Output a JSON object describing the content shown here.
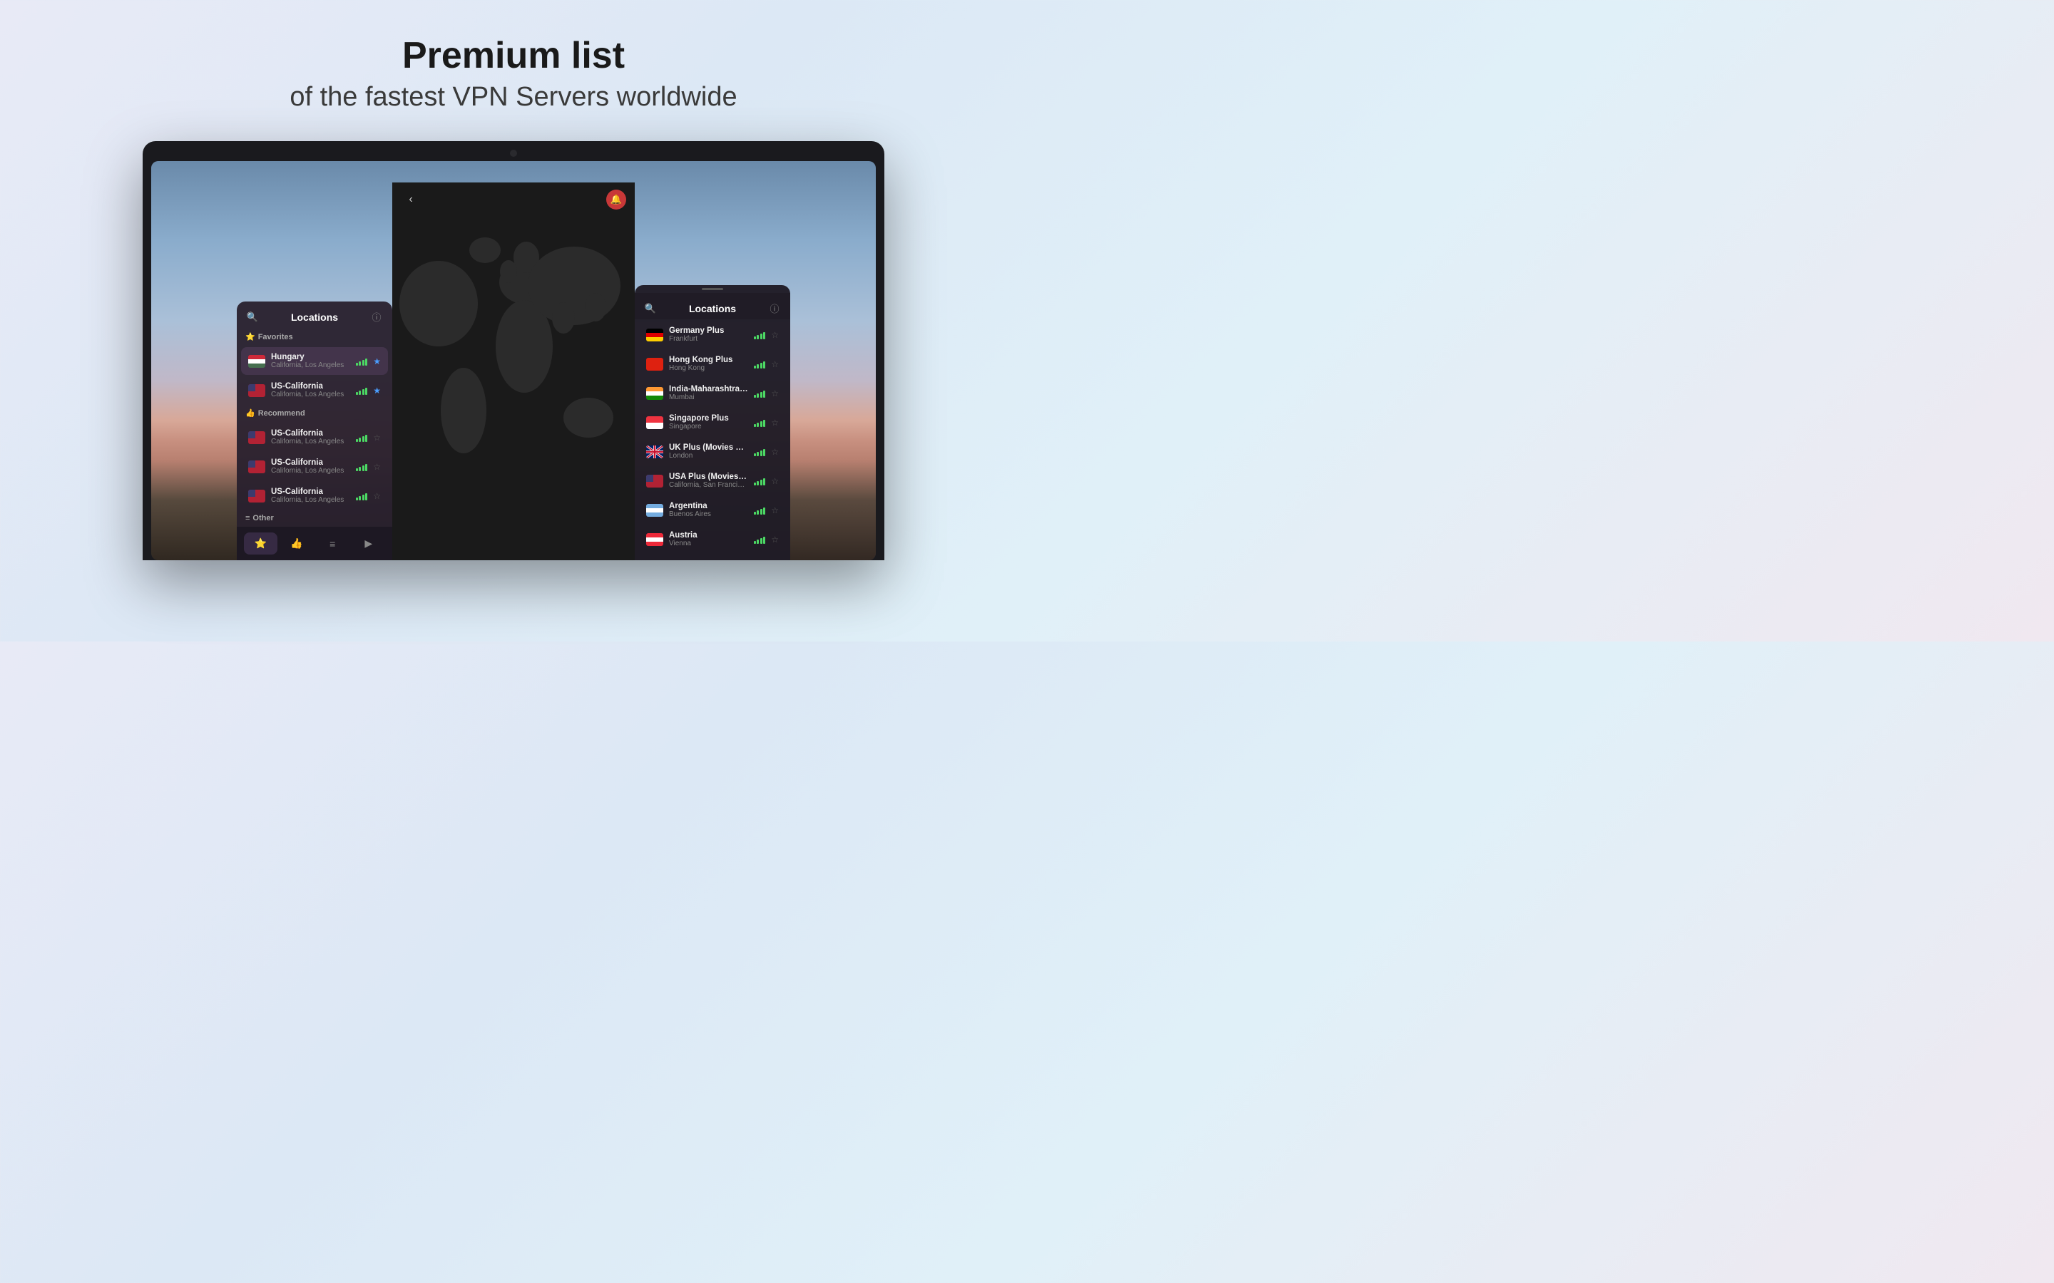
{
  "header": {
    "title": "Premium list",
    "subtitle": "of the fastest VPN Servers worldwide"
  },
  "left_panel": {
    "title": "Locations",
    "search_icon": "🔍",
    "info_icon": "ℹ",
    "sections": [
      {
        "label": "Favorites",
        "icon": "⭐",
        "items": [
          {
            "country": "Hungary",
            "city": "California, Los Angeles",
            "flag": "hu",
            "signal": 4,
            "starred": true
          },
          {
            "country": "US-California",
            "city": "California, Los Angeles",
            "flag": "us",
            "signal": 4,
            "starred": true
          }
        ]
      },
      {
        "label": "Recommend",
        "icon": "👍",
        "items": [
          {
            "country": "US-California",
            "city": "California, Los Angeles",
            "flag": "us",
            "signal": 4,
            "starred": false
          },
          {
            "country": "US-California",
            "city": "California, Los Angeles",
            "flag": "us",
            "signal": 4,
            "starred": false
          },
          {
            "country": "US-California",
            "city": "California, Los Angeles",
            "flag": "us",
            "signal": 4,
            "starred": false
          }
        ]
      },
      {
        "label": "Other",
        "icon": "≡"
      }
    ],
    "tabs": [
      {
        "icon": "⭐",
        "active": true
      },
      {
        "icon": "👍",
        "active": false
      },
      {
        "icon": "≡",
        "active": false
      },
      {
        "icon": "▶",
        "active": false
      }
    ]
  },
  "right_panel": {
    "title": "Locations",
    "search_icon": "🔍",
    "info_icon": "ℹ",
    "items": [
      {
        "country": "Germany Plus",
        "city": "Frankfurt",
        "flag": "de",
        "signal": 4,
        "starred": false
      },
      {
        "country": "Hong Kong Plus",
        "city": "Hong Kong",
        "flag": "hk",
        "signal": 4,
        "starred": false
      },
      {
        "country": "India-Maharashtra Plus",
        "city": "Mumbai",
        "flag": "in",
        "signal": 4,
        "starred": false
      },
      {
        "country": "Singapore Plus",
        "city": "Singapore",
        "flag": "sg",
        "signal": 4,
        "starred": false
      },
      {
        "country": "UK Plus (Movies & TV)",
        "city": "London",
        "flag": "uk",
        "signal": 4,
        "starred": false
      },
      {
        "country": "USA Plus (Movies & TV)",
        "city": "California, San Francisco",
        "flag": "us",
        "signal": 4,
        "starred": false
      },
      {
        "country": "Argentina",
        "city": "Buenos Aires",
        "flag": "ar",
        "signal": 4,
        "starred": false
      },
      {
        "country": "Austria",
        "city": "Vienna",
        "flag": "at",
        "signal": 4,
        "starred": false
      }
    ]
  }
}
